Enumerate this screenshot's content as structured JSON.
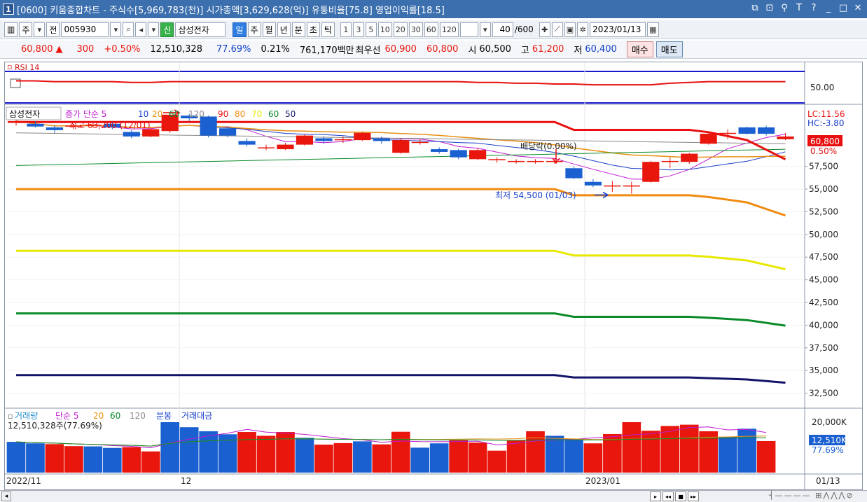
{
  "titlebar": {
    "window_number": "1",
    "title": "[0600] 키움종합차트 - 주식수[5,969,783(천)] 시가총액[3,629,628(억)] 유통비율[75.8] 영업이익률[18.5]"
  },
  "toolbar1": {
    "mode_label": "주",
    "prev_label": "전",
    "stock_code": "005930",
    "shin_label": "신",
    "stock_name": "삼성전자",
    "period_tabs": [
      "일",
      "주",
      "월",
      "년",
      "분",
      "초",
      "틱"
    ],
    "active_period": "일",
    "numbers": [
      "1",
      "3",
      "5",
      "10",
      "20",
      "30",
      "60",
      "120"
    ],
    "count": "40",
    "count_total": "/600",
    "date": "2023/01/13"
  },
  "quote": {
    "price": "60,800",
    "change": "300",
    "change_pct": "+0.50%",
    "volume": "12,510,328",
    "ratio1": "77.69%",
    "ratio2": "0.21%",
    "amount": "761,170백만",
    "best_label": "최우선",
    "best_ask": "60,900",
    "best_bid": "60,800",
    "open_label": "시",
    "open": "60,500",
    "high_label": "고",
    "high": "61,200",
    "low_label": "저",
    "low": "60,400",
    "buy_label": "매수",
    "sell_label": "매도"
  },
  "rsi_panel": {
    "label": "RSI 14",
    "axis_label": "50.00"
  },
  "price_panel": {
    "legend_stock": "삼성전자",
    "legend_ma": "종가 단순 5",
    "legend_periods": [
      "10",
      "20",
      "60",
      "120"
    ],
    "legend_extra": [
      "90",
      "80",
      "70",
      "60",
      "50"
    ],
    "high_annot": "최고 63,200 (12/01)",
    "low_annot": "최저 54,500 (01/03)",
    "div_annot": "배당락(0.00%)",
    "lc_label": "LC:11.56",
    "hc_label": "HC:-3.80",
    "current_price": "60,800",
    "current_pct": "0.50%",
    "axis_labels": [
      "57,500",
      "55,000",
      "52,500",
      "50,000",
      "47,500",
      "45,000",
      "42,500",
      "40,000",
      "37,500",
      "35,000",
      "32,500"
    ]
  },
  "volume_panel": {
    "legend_vol": "거래량",
    "legend_ma": "단순 5",
    "legend_periods": [
      "20",
      "60",
      "120"
    ],
    "legend_bun": "분봉",
    "legend_amount": "거래대금",
    "current_label": "12,510,328주(77.69%)",
    "axis_top": "20,000K",
    "axis_current": "12,510K",
    "axis_pct": "77.69%"
  },
  "date_axis": {
    "labels": [
      "2022/11",
      "12",
      "2023/01"
    ],
    "right_label": "01/13"
  },
  "colors": {
    "up": "#e8160c",
    "down": "#1a60d0",
    "titlebar": "#3c6fae"
  },
  "chart_data": [
    {
      "type": "candlestick",
      "title": "",
      "candles": [
        {
          "o": 62300,
          "c": 62500,
          "h": 62800,
          "l": 62000
        },
        {
          "o": 62200,
          "c": 61900,
          "h": 62500,
          "l": 61800
        },
        {
          "o": 61800,
          "c": 61500,
          "h": 62000,
          "l": 61200
        },
        {
          "o": 61900,
          "c": 62000,
          "h": 62200,
          "l": 61600
        },
        {
          "o": 62000,
          "c": 62100,
          "h": 62300,
          "l": 61800
        },
        {
          "o": 62200,
          "c": 61800,
          "h": 62400,
          "l": 61600
        },
        {
          "o": 61300,
          "c": 60800,
          "h": 61500,
          "l": 60600
        },
        {
          "o": 60800,
          "c": 61600,
          "h": 61800,
          "l": 60700
        },
        {
          "o": 61400,
          "c": 63200,
          "h": 63200,
          "l": 61200
        },
        {
          "o": 63100,
          "c": 62800,
          "h": 63300,
          "l": 62500
        },
        {
          "o": 63000,
          "c": 60900,
          "h": 63100,
          "l": 60700
        },
        {
          "o": 61700,
          "c": 60900,
          "h": 61900,
          "l": 60700
        },
        {
          "o": 60300,
          "c": 59900,
          "h": 60600,
          "l": 59700
        },
        {
          "o": 59500,
          "c": 59600,
          "h": 59900,
          "l": 59300
        },
        {
          "o": 59400,
          "c": 59900,
          "h": 60100,
          "l": 59300
        },
        {
          "o": 59900,
          "c": 60900,
          "h": 61000,
          "l": 59800
        },
        {
          "o": 60600,
          "c": 60300,
          "h": 60800,
          "l": 60000
        },
        {
          "o": 60400,
          "c": 60500,
          "h": 60800,
          "l": 60100
        },
        {
          "o": 60400,
          "c": 61200,
          "h": 61300,
          "l": 60300
        },
        {
          "o": 60600,
          "c": 60300,
          "h": 60800,
          "l": 60000
        },
        {
          "o": 59000,
          "c": 60400,
          "h": 60600,
          "l": 58900
        },
        {
          "o": 60200,
          "c": 60200,
          "h": 60500,
          "l": 59900
        },
        {
          "o": 59400,
          "c": 59100,
          "h": 59600,
          "l": 58900
        },
        {
          "o": 59300,
          "c": 58500,
          "h": 59400,
          "l": 58300
        },
        {
          "o": 58300,
          "c": 59300,
          "h": 59500,
          "l": 58200
        },
        {
          "o": 58200,
          "c": 58300,
          "h": 58500,
          "l": 57900
        },
        {
          "o": 58000,
          "c": 58100,
          "h": 58300,
          "l": 57800
        },
        {
          "o": 58000,
          "c": 58100,
          "h": 58300,
          "l": 57800
        },
        {
          "o": 58100,
          "c": 58100,
          "h": 58400,
          "l": 57800
        },
        {
          "o": 57300,
          "c": 56200,
          "h": 57500,
          "l": 56100
        },
        {
          "o": 55800,
          "c": 55400,
          "h": 56100,
          "l": 55200
        },
        {
          "o": 55300,
          "c": 55400,
          "h": 55900,
          "l": 54700
        },
        {
          "o": 55400,
          "c": 55400,
          "h": 55800,
          "l": 54500
        },
        {
          "o": 55800,
          "c": 58000,
          "h": 58100,
          "l": 55700
        },
        {
          "o": 58000,
          "c": 58100,
          "h": 58500,
          "l": 57300
        },
        {
          "o": 58000,
          "c": 58900,
          "h": 59000,
          "l": 57800
        },
        {
          "o": 60000,
          "c": 61100,
          "h": 61300,
          "l": 59900
        },
        {
          "o": 61200,
          "c": 61200,
          "h": 61600,
          "l": 60500
        },
        {
          "o": 61800,
          "c": 61100,
          "h": 61900,
          "l": 61000
        },
        {
          "o": 61800,
          "c": 61100,
          "h": 62000,
          "l": 60900
        },
        {
          "o": 60500,
          "c": 60800,
          "h": 61200,
          "l": 60400
        }
      ],
      "ylim": [
        31000,
        64500
      ]
    },
    {
      "type": "line",
      "title": "",
      "series": [
        {
          "name": "",
          "values": [
            58,
            58,
            57,
            57,
            57,
            57,
            56,
            56,
            57,
            57,
            57,
            57,
            57,
            57,
            57,
            57,
            57,
            57,
            57,
            57,
            57,
            57,
            57,
            57,
            56,
            56,
            55,
            55,
            54,
            54,
            53,
            53,
            53,
            53,
            55,
            56,
            57,
            57,
            57,
            57,
            57
          ]
        }
      ],
      "ylim": [
        0,
        100
      ]
    },
    {
      "type": "bar",
      "title": "",
      "values": [
        12200,
        11600,
        11300,
        10500,
        10400,
        9800,
        10100,
        8400,
        20000,
        18000,
        16400,
        15200,
        16100,
        14600,
        16100,
        13800,
        11100,
        11700,
        12400,
        11200,
        16200,
        9900,
        11600,
        12800,
        11900,
        8700,
        12900,
        16400,
        14600,
        13400,
        11600,
        15300,
        20000,
        16600,
        18500,
        19000,
        16400,
        14200,
        17400,
        12510
      ],
      "ylim": [
        0,
        20000
      ]
    }
  ]
}
